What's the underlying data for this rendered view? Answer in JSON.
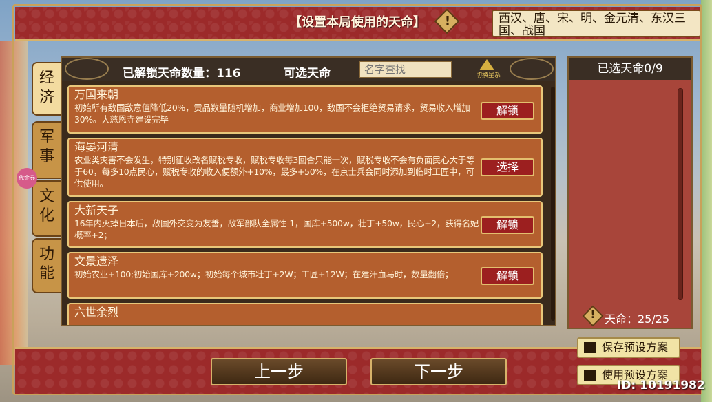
{
  "header": {
    "title": "【设置本局使用的天命】",
    "dynasty_list": "西汉、唐、宋、明、金元清、东汉三国、战国"
  },
  "side_tabs": [
    {
      "label": "经济"
    },
    {
      "label": "军事"
    },
    {
      "label": "文化"
    },
    {
      "label": "功能"
    }
  ],
  "main": {
    "unlocked_count_label": "已解锁天命数量：116",
    "selectable_label": "可选天命",
    "search_placeholder": "名字查找",
    "switch_era_label": "切换星系"
  },
  "cards": [
    {
      "title": "万国来朝",
      "desc": "初始所有敌国敌意值降低20%，贡品数量随机增加，商业增加100，敌国不会拒绝贸易请求，贸易收入增加30%。大慈恩寺建设完毕",
      "button": "解锁"
    },
    {
      "title": "海晏河清",
      "desc": "农业类灾害不会发生，特别征收改名赋税专收，赋税专收每3回合只能一次，赋税专收不会有负面民心大于等于60，每多10点民心，赋税专收的收入便额外+10%，最多+50%，在京士兵会同时添加到临时工匠中，可供使用。",
      "button": "选择"
    },
    {
      "title": "大新天子",
      "desc": "16年内灭掉日本后，敌国外交变为友善，敌军部队全属性-1，国库+500w，壮丁+50w，民心+2，获得名妃概率+2；",
      "button": "解锁"
    },
    {
      "title": "文景遗泽",
      "desc": "初始农业+100;初始国库+200w；初始每个城市壮丁+2W；工匠+12W；在建汗血马时，数量翻倍；",
      "button": "解锁"
    },
    {
      "title": "六世余烈",
      "desc": "",
      "button": ""
    }
  ],
  "right_panel": {
    "selected_label": "已选天命0/9",
    "tianming_label": "天命：25/25"
  },
  "footer": {
    "prev_label": "上一步",
    "next_label": "下一步",
    "save_preset_label": "保存预设方案",
    "use_preset_label": "使用预设方案",
    "id_label": "ID: 10191982",
    "badge_label": "代金券"
  },
  "colors": {
    "banner_red": "#9c2a2a",
    "card_orange": "#b45f2e",
    "gold_border": "#e8c77a",
    "button_red": "#9c1f1f"
  }
}
